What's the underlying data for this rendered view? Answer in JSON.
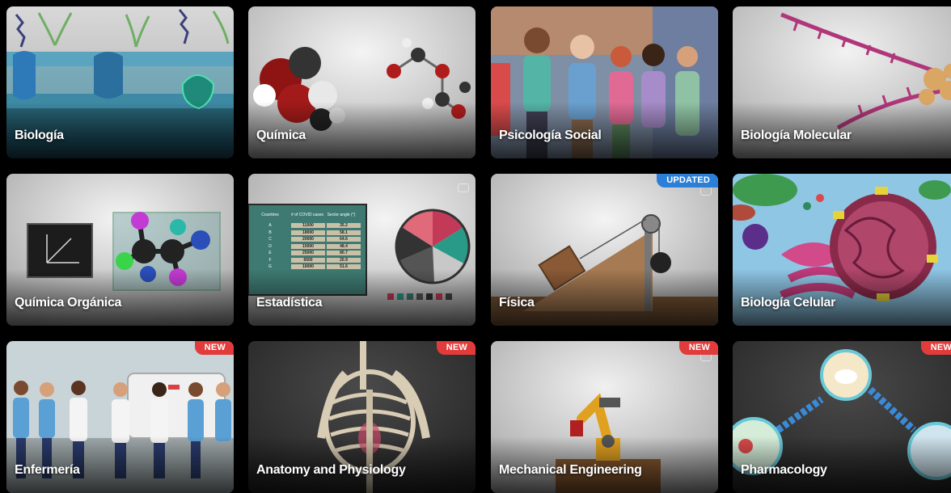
{
  "courses": [
    {
      "label": "Biología",
      "badge": ""
    },
    {
      "label": "Química",
      "badge": ""
    },
    {
      "label": "Psicología Social",
      "badge": ""
    },
    {
      "label": "Biología Molecular",
      "badge": ""
    },
    {
      "label": "Química Orgánica",
      "badge": ""
    },
    {
      "label": "Estadística",
      "badge": ""
    },
    {
      "label": "Física",
      "badge": "UPDATED"
    },
    {
      "label": "Biología Celular",
      "badge": ""
    },
    {
      "label": "Enfermería",
      "badge": "NEW"
    },
    {
      "label": "Anatomy and Physiology",
      "badge": "NEW"
    },
    {
      "label": "Mechanical Engineering",
      "badge": "NEW"
    },
    {
      "label": "Pharmacology",
      "badge": "NEW"
    }
  ],
  "stats_table": {
    "headers": [
      "Countries",
      "# of COVID cases",
      "Sector angle (°)"
    ],
    "rows": [
      [
        "A",
        "11000",
        "35.2"
      ],
      [
        "B",
        "18000",
        "58.1"
      ],
      [
        "C",
        "20000",
        "64.6"
      ],
      [
        "D",
        "15000",
        "48.4"
      ],
      [
        "E",
        "25000",
        "80.7"
      ],
      [
        "F",
        "6500",
        "20.9"
      ],
      [
        "G",
        "16000",
        "51.6"
      ]
    ]
  },
  "colors": {
    "new_badge": "#e23b3b",
    "updated_badge": "#2b7fd6",
    "background": "#000000"
  }
}
